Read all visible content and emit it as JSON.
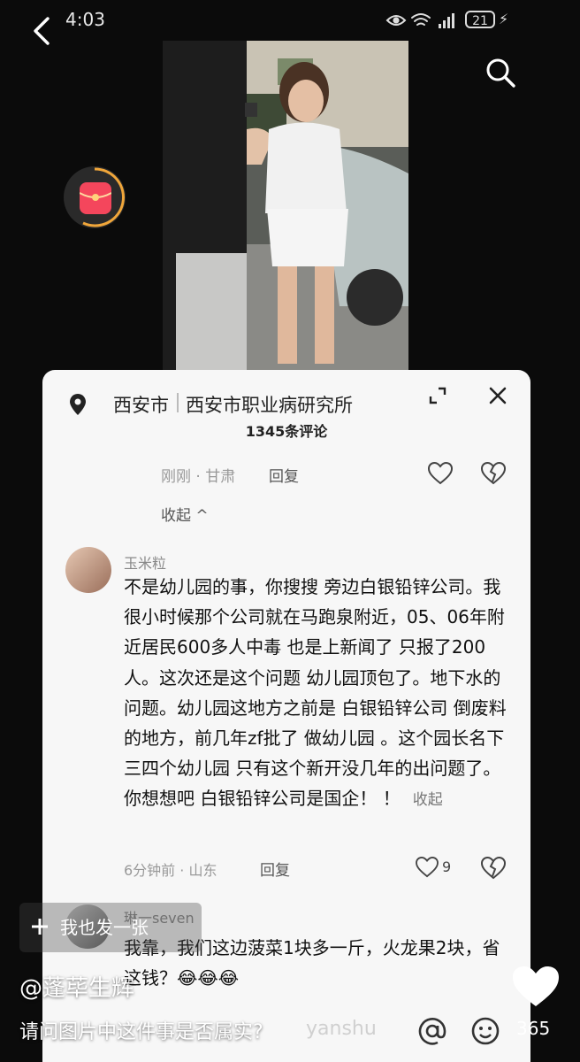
{
  "status_bar": {
    "time": "4:03",
    "battery": "21"
  },
  "comments_panel": {
    "location_city": "西安市",
    "location_place": "西安市职业病研究所",
    "comment_count": "1345条评论",
    "previous_reply": {
      "time": "刚刚",
      "region": "甘肃",
      "reply_label": "回复"
    },
    "collapse_label": "收起 ^",
    "comments": [
      {
        "username": "玉米粒",
        "text": "不是幼儿园的事，你搜搜 旁边白银铅锌公司。我很小时候那个公司就在马跑泉附近，05、06年附近居民600多人中毒 也是上新闻了 只报了200人。这次还是这个问题 幼儿园顶包了。地下水的问题。幼儿园这地方之前是 白银铅锌公司 倒废料的地方，前几年zf批了 做幼儿园 。这个园长名下三四个幼儿园 只有这个新开没几年的出问题了。你想想吧 白银铅锌公司是国企！ ！",
        "fold_label": "收起",
        "time": "6分钟前",
        "region": "山东",
        "reply_label": "回复",
        "likes": "9"
      },
      {
        "username": "琳一seven",
        "text": "我靠，我们这边菠菜1块多一斤，火龙果2块，省这钱？",
        "emoji": "😂😂😂"
      }
    ]
  },
  "overlay": {
    "post_button": "我也发一张",
    "author": "@蓬荜生辉",
    "caption": "请问图片中这件事是否属实?",
    "like_count": "365",
    "watermark": "yanshu"
  },
  "icons": [
    "back-icon",
    "eye-icon",
    "wifi-icon",
    "signal-icon",
    "battery-icon",
    "search-icon",
    "red-packet-icon",
    "location-icon",
    "expand-icon",
    "close-icon",
    "heart-icon",
    "broken-heart-icon",
    "plus-icon",
    "at-icon",
    "emoji-icon"
  ],
  "colors": {
    "red_packet": "#f4465c",
    "sheet_bg": "#f7f7f7"
  }
}
